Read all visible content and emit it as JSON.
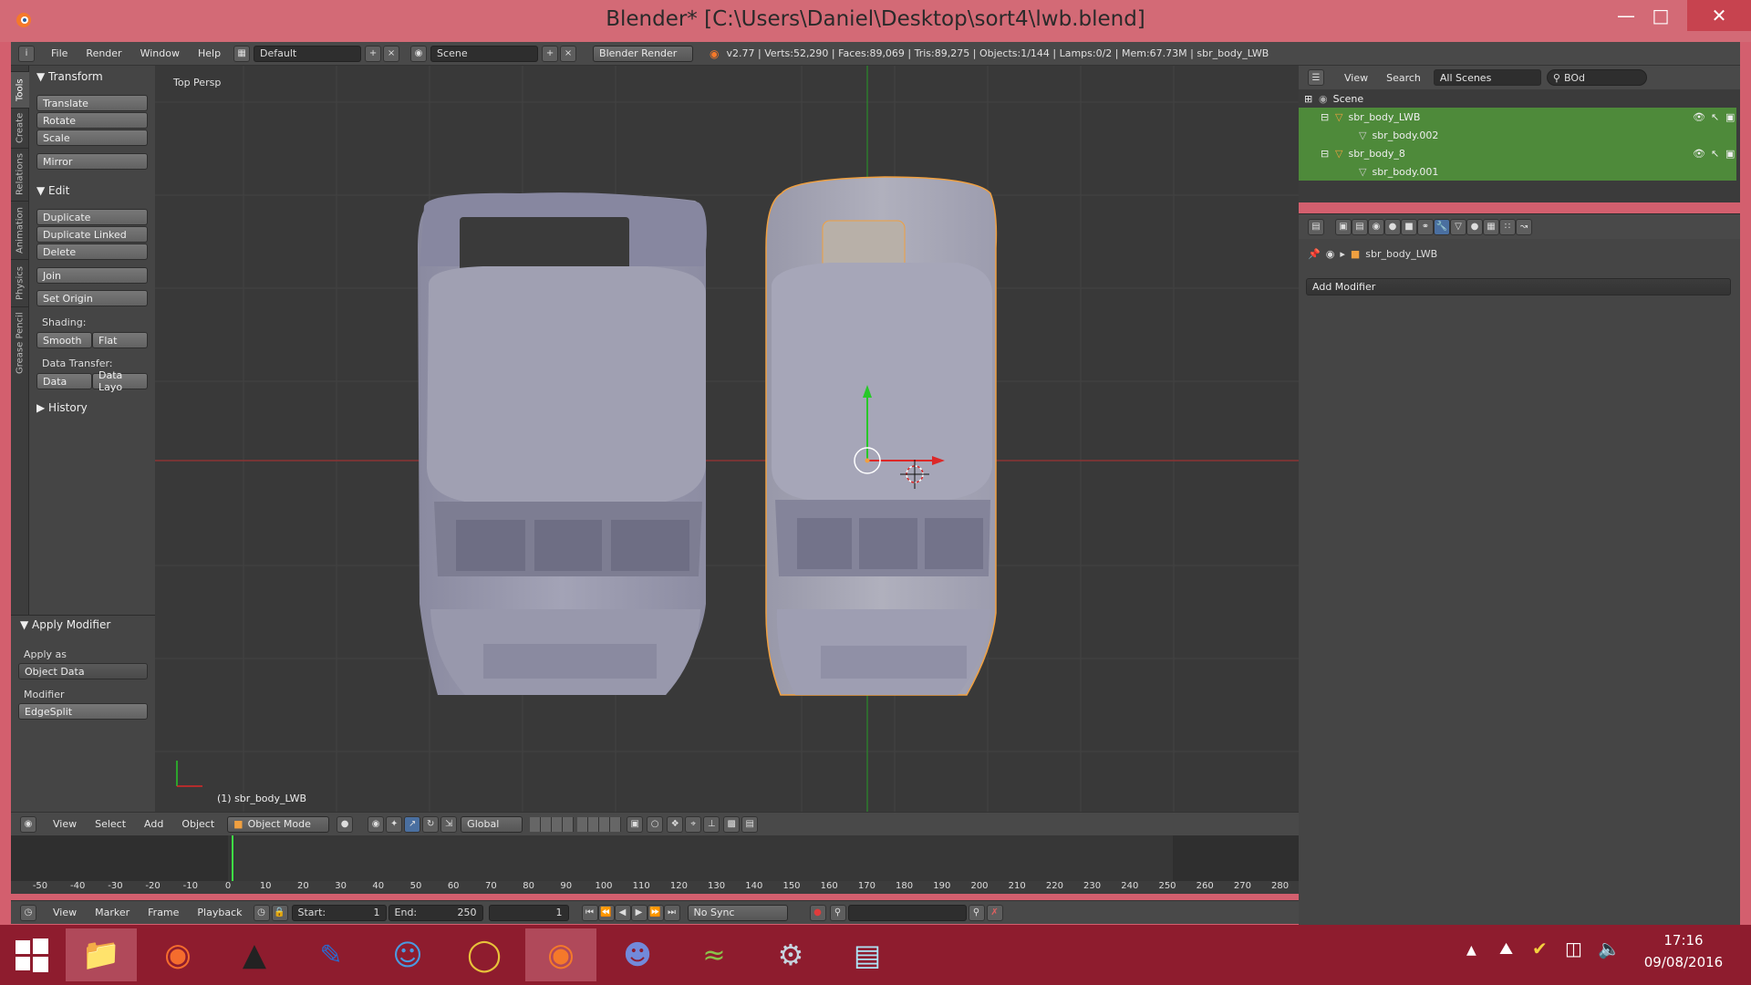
{
  "window": {
    "title": "Blender* [C:\\Users\\Daniel\\Desktop\\sort4\\lwb.blend]"
  },
  "infobar": {
    "menus": [
      "File",
      "Render",
      "Window",
      "Help"
    ],
    "layout": "Default",
    "scene": "Scene",
    "engine": "Blender Render",
    "stats": "v2.77 | Verts:52,290 | Faces:89,069 | Tris:89,275 | Objects:1/144 | Lamps:0/2 | Mem:67.73M | sbr_body_LWB"
  },
  "tabs": [
    "Tools",
    "Create",
    "Relations",
    "Animation",
    "Physics",
    "Grease Pencil"
  ],
  "toolshelf": {
    "transform_header": "Transform",
    "translate": "Translate",
    "rotate": "Rotate",
    "scale": "Scale",
    "mirror": "Mirror",
    "edit_header": "Edit",
    "duplicate": "Duplicate",
    "duplicate_linked": "Duplicate Linked",
    "delete": "Delete",
    "join": "Join",
    "set_origin": "Set Origin",
    "shading_label": "Shading:",
    "smooth": "Smooth",
    "flat": "Flat",
    "data_transfer_label": "Data Transfer:",
    "data": "Data",
    "data_layo": "Data Layo",
    "history_header": "History"
  },
  "operator": {
    "header": "Apply Modifier",
    "apply_as_label": "Apply as",
    "apply_as_value": "Object Data",
    "modifier_label": "Modifier",
    "modifier_value": "EdgeSplit"
  },
  "viewport": {
    "view_label": "Top Persp",
    "active_object": "(1) sbr_body_LWB"
  },
  "viewheader": {
    "menus": [
      "View",
      "Select",
      "Add",
      "Object"
    ],
    "mode": "Object Mode",
    "orientation": "Global"
  },
  "timeline": {
    "ticks": [
      "-50",
      "-40",
      "-30",
      "-20",
      "-10",
      "0",
      "10",
      "20",
      "30",
      "40",
      "50",
      "60",
      "70",
      "80",
      "90",
      "100",
      "110",
      "120",
      "130",
      "140",
      "150",
      "160",
      "170",
      "180",
      "190",
      "200",
      "210",
      "220",
      "230",
      "240",
      "250",
      "260",
      "270",
      "280"
    ],
    "menus": [
      "View",
      "Marker",
      "Frame",
      "Playback"
    ],
    "start_label": "Start:",
    "start": "1",
    "end_label": "End:",
    "end": "250",
    "current": "1",
    "sync": "No Sync"
  },
  "outliner": {
    "menus": [
      "View",
      "Search"
    ],
    "scenes": "All Scenes",
    "search": "BOd",
    "items": [
      {
        "label": "Scene"
      },
      {
        "label": "sbr_body_LWB"
      },
      {
        "label": "sbr_body.002"
      },
      {
        "label": "sbr_body_8"
      },
      {
        "label": "sbr_body.001"
      }
    ]
  },
  "properties": {
    "object_name": "sbr_body_LWB",
    "add_modifier": "Add Modifier"
  },
  "taskbar": {
    "time": "17:16",
    "date": "09/08/2016"
  },
  "colors": {
    "accent": "#d35f6e",
    "selected_row": "#4e8a3a",
    "x_axis": "#c83232",
    "y_axis": "#28c828",
    "selection_outline": "#f0a040"
  }
}
